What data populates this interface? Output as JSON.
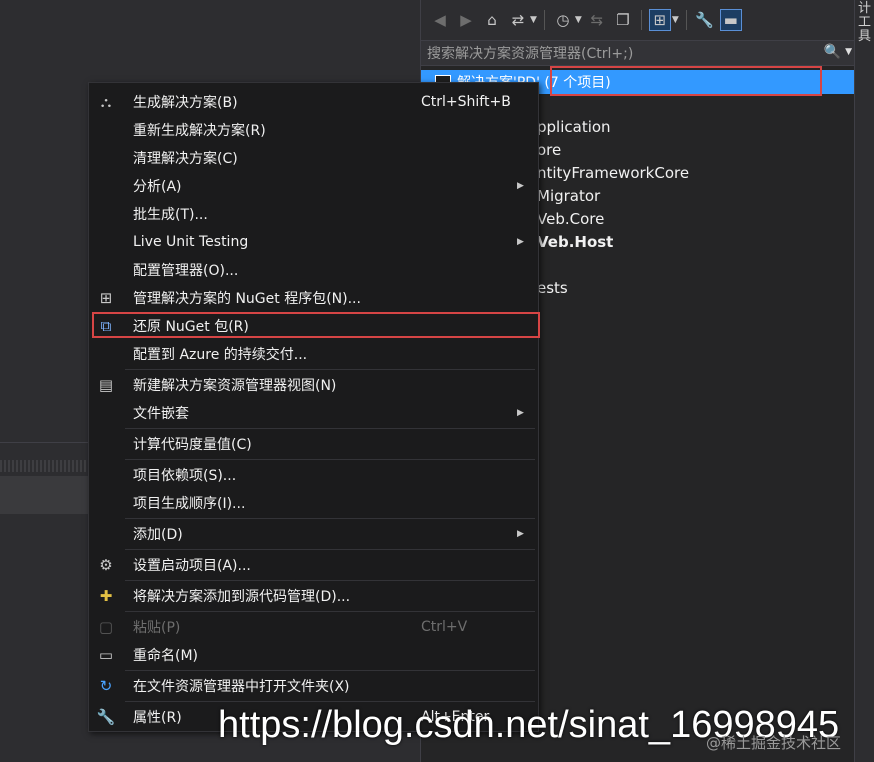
{
  "solution_explorer": {
    "search_placeholder": "搜索解决方案资源管理器(Ctrl+;)",
    "solution_label": "解决方案'PD' (7 个项目)",
    "items": [
      {
        "label": "pplication",
        "bold": false
      },
      {
        "label": "ore",
        "bold": false
      },
      {
        "label": "ntityFrameworkCore",
        "bold": false
      },
      {
        "label": "Migrator",
        "bold": false
      },
      {
        "label": "Veb.Core",
        "bold": false
      },
      {
        "label": "Veb.Host",
        "bold": true
      },
      {
        "label": "ests",
        "bold": false
      }
    ],
    "side_tab_text": "计工具"
  },
  "context_menu": {
    "items": [
      {
        "icon": "build-icon",
        "label": "生成解决方案(B)",
        "shortcut": "Ctrl+Shift+B",
        "submenu": false,
        "disabled": false
      },
      {
        "icon": "",
        "label": "重新生成解决方案(R)",
        "shortcut": "",
        "submenu": false,
        "disabled": false
      },
      {
        "icon": "",
        "label": "清理解决方案(C)",
        "shortcut": "",
        "submenu": false,
        "disabled": false
      },
      {
        "icon": "",
        "label": "分析(A)",
        "shortcut": "",
        "submenu": true,
        "disabled": false
      },
      {
        "icon": "",
        "label": "批生成(T)...",
        "shortcut": "",
        "submenu": false,
        "disabled": false
      },
      {
        "icon": "",
        "label": "Live Unit Testing",
        "shortcut": "",
        "submenu": true,
        "disabled": false
      },
      {
        "icon": "",
        "label": "配置管理器(O)...",
        "shortcut": "",
        "submenu": false,
        "disabled": false
      },
      {
        "icon": "nuget-package-icon",
        "label": "管理解决方案的 NuGet 程序包(N)...",
        "shortcut": "",
        "submenu": false,
        "disabled": false
      },
      {
        "icon": "restore-package-icon",
        "label": "还原 NuGet 包(R)",
        "shortcut": "",
        "submenu": false,
        "disabled": false
      },
      {
        "icon": "",
        "label": "配置到 Azure 的持续交付...",
        "shortcut": "",
        "submenu": false,
        "disabled": false
      },
      {
        "icon": "new-view-icon",
        "label": "新建解决方案资源管理器视图(N)",
        "shortcut": "",
        "submenu": false,
        "disabled": false
      },
      {
        "icon": "",
        "label": "文件嵌套",
        "shortcut": "",
        "submenu": true,
        "disabled": false
      },
      {
        "icon": "",
        "label": "计算代码度量值(C)",
        "shortcut": "",
        "submenu": false,
        "disabled": false
      },
      {
        "icon": "",
        "label": "项目依赖项(S)...",
        "shortcut": "",
        "submenu": false,
        "disabled": false
      },
      {
        "icon": "",
        "label": "项目生成顺序(I)...",
        "shortcut": "",
        "submenu": false,
        "disabled": false
      },
      {
        "icon": "",
        "label": "添加(D)",
        "shortcut": "",
        "submenu": true,
        "disabled": false
      },
      {
        "icon": "gear-icon",
        "label": "设置启动项目(A)...",
        "shortcut": "",
        "submenu": false,
        "disabled": false
      },
      {
        "icon": "source-control-add-icon",
        "label": "将解决方案添加到源代码管理(D)...",
        "shortcut": "",
        "submenu": false,
        "disabled": false
      },
      {
        "icon": "paste-icon",
        "label": "粘贴(P)",
        "shortcut": "Ctrl+V",
        "submenu": false,
        "disabled": true
      },
      {
        "icon": "rename-icon",
        "label": "重命名(M)",
        "shortcut": "",
        "submenu": false,
        "disabled": false
      },
      {
        "icon": "open-folder-icon",
        "label": "在文件资源管理器中打开文件夹(X)",
        "shortcut": "",
        "submenu": false,
        "disabled": false
      },
      {
        "icon": "wrench-icon",
        "label": "属性(R)",
        "shortcut": "Alt+Enter",
        "submenu": false,
        "disabled": false
      }
    ]
  },
  "watermark": "https://blog.csdn.net/sinat_16998945",
  "watermark_small": "@稀土掘金技术社区"
}
